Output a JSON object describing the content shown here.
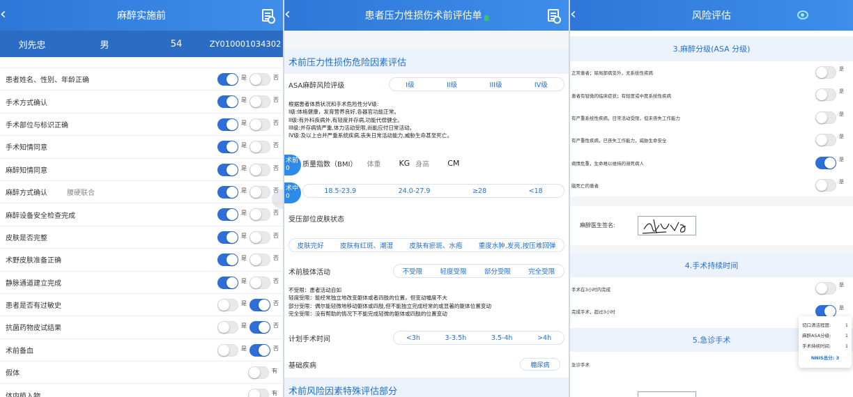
{
  "p1": {
    "title": "麻醉实施前",
    "patient": [
      "刘先忠",
      "男",
      "54",
      "ZY010001034302"
    ],
    "items": [
      {
        "label": "患者姓名、性别、年龄正确",
        "extra": "",
        "yes": true,
        "no": false
      },
      {
        "label": "手术方式确认",
        "extra": "",
        "yes": true,
        "no": false
      },
      {
        "label": "手术部位与标识正确",
        "extra": "",
        "yes": true,
        "no": false
      },
      {
        "label": "手术知情同意",
        "extra": "",
        "yes": true,
        "no": false
      },
      {
        "label": "麻醉知情同意",
        "extra": "",
        "yes": true,
        "no": false
      },
      {
        "label": "麻醉方式确认",
        "extra": "腰硬联合",
        "yes": true,
        "no": false
      },
      {
        "label": "麻醉设备安全检查完成",
        "extra": "",
        "yes": true,
        "no": false
      },
      {
        "label": "皮肤是否完整",
        "extra": "",
        "yes": true,
        "no": false
      },
      {
        "label": "术野皮肤准备正确",
        "extra": "",
        "yes": true,
        "no": false
      },
      {
        "label": "静脉通道建立完成",
        "extra": "",
        "yes": true,
        "no": false
      },
      {
        "label": "患者是否有过敏史",
        "extra": "",
        "yes": false,
        "no": true
      },
      {
        "label": "抗菌药物皮试结果",
        "extra": "",
        "yes": false,
        "no": true
      },
      {
        "label": "术前备血",
        "extra": "",
        "yes": false,
        "no": true
      },
      {
        "label": "假体",
        "extra": "",
        "single": true,
        "on": false,
        "text": "有"
      },
      {
        "label": "体内植入物",
        "extra": "",
        "single": true,
        "on": false,
        "text": "有"
      }
    ],
    "yes": "是",
    "no": "否"
  },
  "p2": {
    "title": "患者压力性损伤术前评估单",
    "section1": "术前压力性损伤危险因素评估",
    "asa_label": "ASA麻醉风险评级",
    "asa_opts": [
      "I级",
      "II级",
      "III级",
      "IV级"
    ],
    "asa_note": [
      "根据患者体质状况和手术危险性分V级:",
      "I级:体格健康，发育营养良好,各器官功能正常。",
      "II级:有外科疾病外,有轻度并存病,功能代偿健全。",
      "III级:并存病情严重,体力活动受限,尚能应付日常活动。",
      "IV级:及以上合并严重系统疾病,丧失日常活动能力,威胁生命甚至死亡。"
    ],
    "bmi_label": "质量指数（BMI）",
    "weight": "体重",
    "kg": "KG",
    "height": "身高",
    "cm": "CM",
    "bubble1": [
      "术前",
      "0"
    ],
    "bubble2": [
      "术中",
      "0"
    ],
    "bmi_opts": [
      "18.5-23.9",
      "24.0-27.9",
      "≥28",
      "<18"
    ],
    "skin_label": "受压部位皮肤状态",
    "skin_opts": [
      "皮肤完好",
      "皮肤有红斑、潮湿",
      "皮肤有瘀斑、水疱",
      "重度水肿,发亮,按压难回弹"
    ],
    "limb_label": "术前肢体活动",
    "limb_opts": [
      "不受限",
      "轻度受限",
      "部分受限",
      "完全受限"
    ],
    "limb_note": [
      "不受限：患者活动自如",
      "轻度受限：能经常独立地改变躯体或者四肢的位置，但变动幅度不大",
      "部分受限：偶尔能轻微地移动躯体或四肢,但不能独立完成经常的或显著的躯体位置变动",
      "完全受限：没有帮助的情况下不能完成轻微的躯体或四肢的位置变动"
    ],
    "time_label": "计划手术时间",
    "time_opts": [
      "<3h",
      "3-3.5h",
      "3.5-4h",
      ">4h"
    ],
    "disease_label": "基础疾病",
    "disease_val": "糖尿病",
    "section2": "术前风险因素特殊评估部分"
  },
  "p3": {
    "title": "风险评估",
    "sec3": "3.麻醉分级(ASA 分级)",
    "asa_items": [
      {
        "label": "正常患者；除局部病变外，无系统性疾病",
        "on": false
      },
      {
        "label": "患者有轻微的临床症状；有轻度或中度系统性疾病",
        "on": false
      },
      {
        "label": "有严重系统性疾病，日常活动受限，但未丧失工作能力",
        "on": false
      },
      {
        "label": "有严重性疾病，已丧失工作能力，威胁生命安全",
        "on": false
      },
      {
        "label": "病情危重，生命难以维持的濒死病人",
        "on": true
      },
      {
        "label": "脑死亡的患者",
        "on": false
      }
    ],
    "yes": "是",
    "sig_label": "麻醉医生签名:",
    "sec4": "4.手术持续时间",
    "dur_items": [
      {
        "label": "手术在3小时内完成",
        "on": false
      },
      {
        "label": "完成手术，超过3小时",
        "on": true
      }
    ],
    "sec5": "5.急诊手术",
    "emerg_label": "急诊手术",
    "popup": [
      {
        "k": "切口清洁程度:",
        "v": "1"
      },
      {
        "k": "麻醉ASA分级:",
        "v": "1"
      },
      {
        "k": "手术持续时间:",
        "v": "1"
      }
    ],
    "popup_total": "NNIS总分:  3"
  }
}
